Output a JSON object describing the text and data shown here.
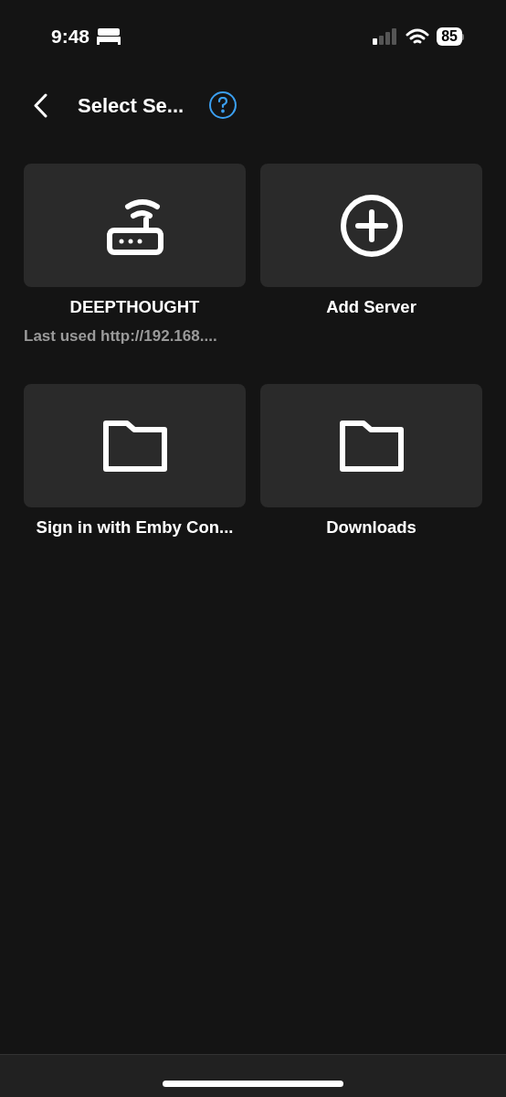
{
  "status_bar": {
    "time": "9:48",
    "battery": "85"
  },
  "header": {
    "title": "Select Se..."
  },
  "items": [
    {
      "kind": "router",
      "label": "DEEPTHOUGHT",
      "subtitle": "Last used http://192.168...."
    },
    {
      "kind": "add",
      "label": "Add Server"
    },
    {
      "kind": "folder",
      "label": "Sign in with Emby Con..."
    },
    {
      "kind": "folder",
      "label": "Downloads"
    }
  ]
}
